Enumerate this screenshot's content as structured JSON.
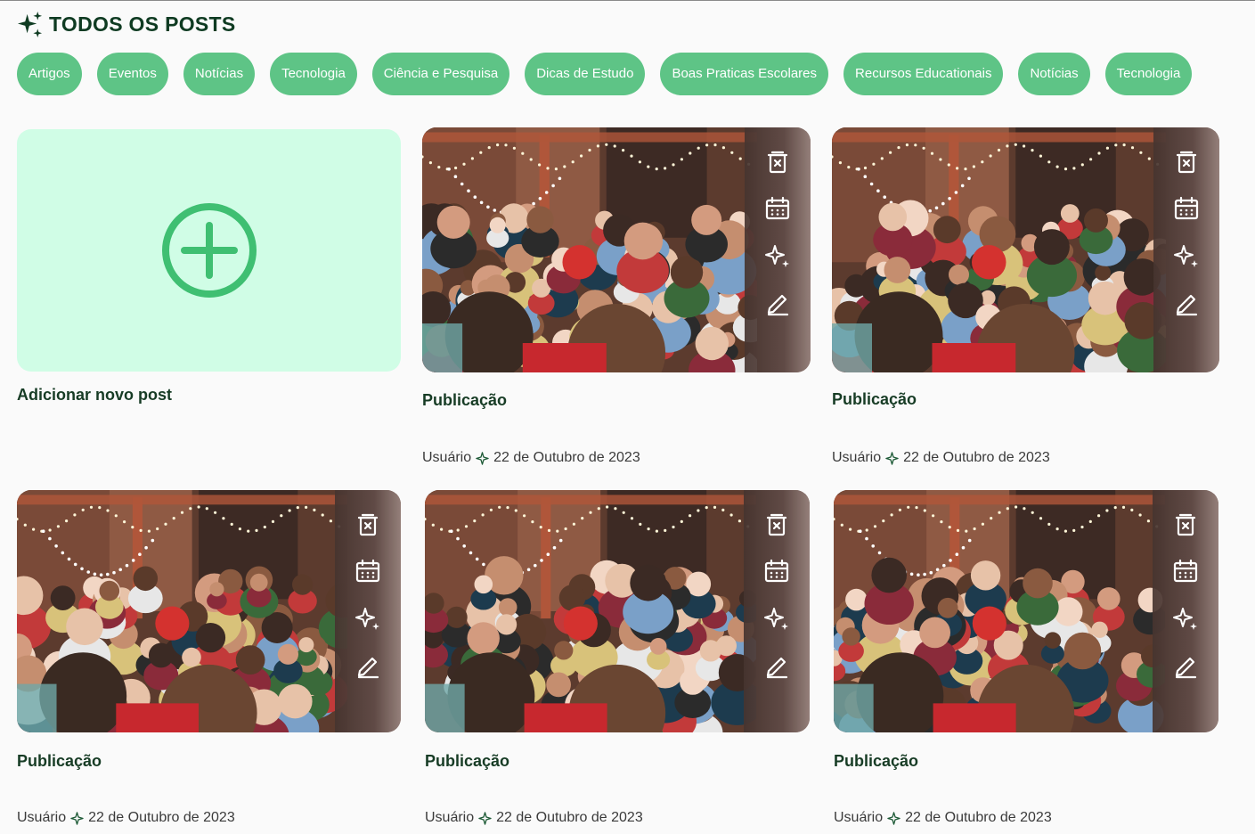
{
  "header": {
    "title": "TODOS OS POSTS",
    "icon": "sparkles-icon"
  },
  "categories": [
    "Artigos",
    "Eventos",
    "Notícias",
    "Tecnologia",
    "Ciência e Pesquisa",
    "Dicas de Estudo",
    "Boas Praticas Escolares",
    "Recursos Educationais",
    "Notícias",
    "Tecnologia"
  ],
  "add_post": {
    "label": "Adicionar novo post",
    "icon": "plus-circle-icon"
  },
  "posts": [
    {
      "title": "Publicação",
      "author": "Usuário",
      "date": "22 de Outubro de 2023"
    },
    {
      "title": "Publicação",
      "author": "Usuário",
      "date": "22 de Outubro de 2023"
    },
    {
      "title": "Publicação",
      "author": "Usuário",
      "date": "22 de Outubro de 2023"
    },
    {
      "title": "Publicação",
      "author": "Usuário",
      "date": "22 de Outubro de 2023"
    },
    {
      "title": "Publicação",
      "author": "Usuário",
      "date": "22 de Outubro de 2023"
    }
  ],
  "post_actions": [
    "delete-icon",
    "calendar-icon",
    "sparkles-icon",
    "edit-icon"
  ],
  "colors": {
    "accent": "#5ec486",
    "add_tile_bg": "#d0fde6",
    "title": "#0f3b22",
    "plus": "#3fbf72"
  }
}
